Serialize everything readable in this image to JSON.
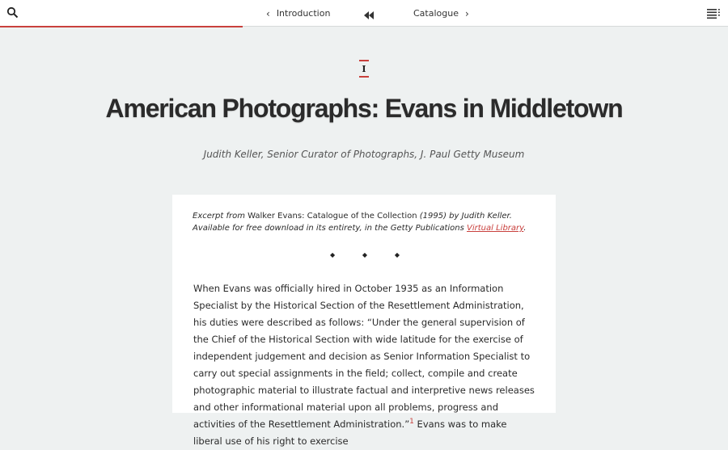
{
  "nav": {
    "prev_label": "Introduction",
    "prev_chevron": "‹",
    "next_label": "Catalogue",
    "next_chevron": "›",
    "progress_fraction": 0.333
  },
  "section_marker": "I",
  "title": "American Photographs: Evans in Middletown",
  "byline": "Judith Keller, Senior Curator of Photographs, J. Paul Getty Museum",
  "excerpt": {
    "prefix": "Excerpt from ",
    "book": "Walker Evans: Catalogue of the Collection",
    "middle": " (1995) by Judith Keller. Available for free download in its entirety, in the Getty Publications ",
    "link": "Virtual Library",
    "suffix": "."
  },
  "ornament": [
    "◆",
    "◆",
    "◆"
  ],
  "body": {
    "text": "When Evans was officially hired in October 1935 as an Information Specialist by the Historical Section of the Resettlement Administration, his duties were described as follows: “Under the general supervision of the Chief of the Historical Section with wide latitude for the exercise of independent judgement and decision as Senior Information Specialist to carry out special assignments in the field; collect, compile and create photographic material to illustrate factual and interpretive news releases and other informational material upon all problems, progress and activities of the Resettlement Administration.”",
    "footnote": "1",
    "continuation": " Evans was to make liberal use of his right to exercise"
  },
  "colors": {
    "accent": "#c9403d",
    "page_bg": "#eef1f1",
    "card_bg": "#ffffff"
  },
  "icons": {
    "search": "search-icon",
    "menu": "menu-icon",
    "home": "rewind-icon"
  }
}
